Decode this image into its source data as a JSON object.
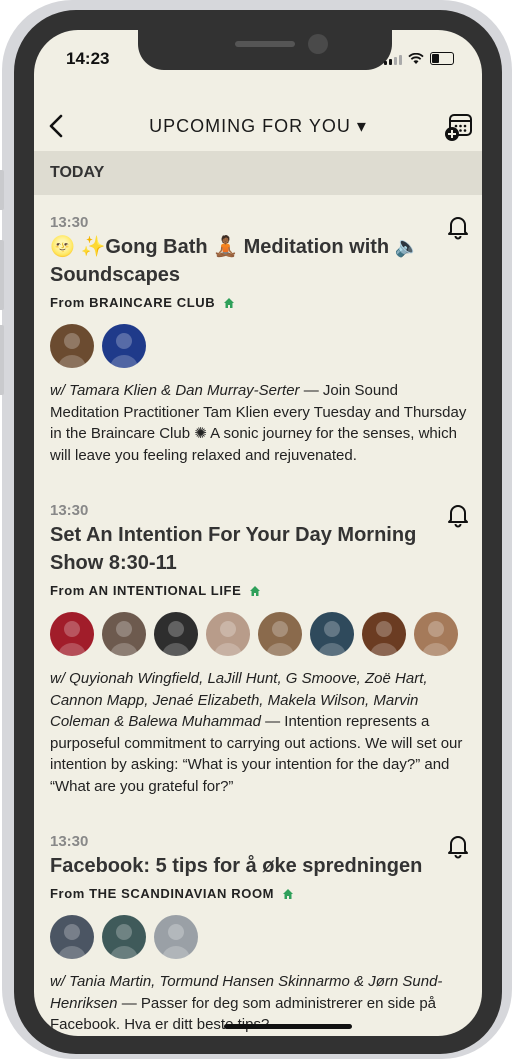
{
  "status": {
    "time": "14:23"
  },
  "header": {
    "title": "UPCOMING FOR YOU ▾"
  },
  "section": {
    "label": "TODAY"
  },
  "events": [
    {
      "time": "13:30",
      "title_line1": "🌝 ✨Gong Bath 🧘🏾 Meditation with 🔈",
      "title_line2": "Soundscapes",
      "club": "From BRAINCARE CLUB",
      "avatars": [
        {
          "name": "avatar-1",
          "color": "#6b4b30"
        },
        {
          "name": "avatar-2",
          "color": "#1f3a8a"
        }
      ],
      "names": "w/ Tamara Klien & Dan Murray-Serter",
      "desc": " — Join Sound Meditation Practitioner Tam Klien every Tuesday and Thursday in the Braincare Club ✺ A sonic journey for the senses, which will leave you feeling relaxed and rejuvenated."
    },
    {
      "time": "13:30",
      "title_line1": "Set An Intention For Your Day Morning",
      "title_line2": "Show 8:30-11",
      "club": "From AN INTENTIONAL LIFE",
      "avatars": [
        {
          "name": "avatar-1",
          "color": "#a11d2a"
        },
        {
          "name": "avatar-2",
          "color": "#6d5a4e"
        },
        {
          "name": "avatar-3",
          "color": "#2e2e2e"
        },
        {
          "name": "avatar-4",
          "color": "#b89c8a"
        },
        {
          "name": "avatar-5",
          "color": "#8a6a4c"
        },
        {
          "name": "avatar-6",
          "color": "#2f4a5c"
        },
        {
          "name": "avatar-7",
          "color": "#6b3c22"
        },
        {
          "name": "avatar-8",
          "color": "#a57a5a"
        }
      ],
      "names": "w/ Quyionah Wingfield, LaJill Hunt, G Smoove, Zoë Hart, Cannon Mapp, Jenaé Elizabeth, Makela Wilson, Marvin Coleman & Balewa Muhammad",
      "desc": " — Intention represents a purposeful commitment to carrying out actions. We will set our intention by asking: “What is your intention for the day?” and “What are you grateful for?”"
    },
    {
      "time": "13:30",
      "title_line1": "Facebook: 5 tips for å øke spredningen",
      "title_line2": "",
      "club": "From THE SCANDINAVIAN ROOM",
      "avatars": [
        {
          "name": "avatar-1",
          "color": "#4b5563"
        },
        {
          "name": "avatar-2",
          "color": "#3f5a5a"
        },
        {
          "name": "avatar-3",
          "color": "#9aa0a6"
        }
      ],
      "names": "w/ Tania Martin, Tormund Hansen Skinnarmo & Jørn Sund-Henriksen",
      "desc": " — Passer for deg som administrerer en side på Facebook. Hva er ditt beste tips?"
    }
  ],
  "colors": {
    "background": "#f1efe4",
    "section": "#dedcd1",
    "house": "#2fa05a"
  }
}
